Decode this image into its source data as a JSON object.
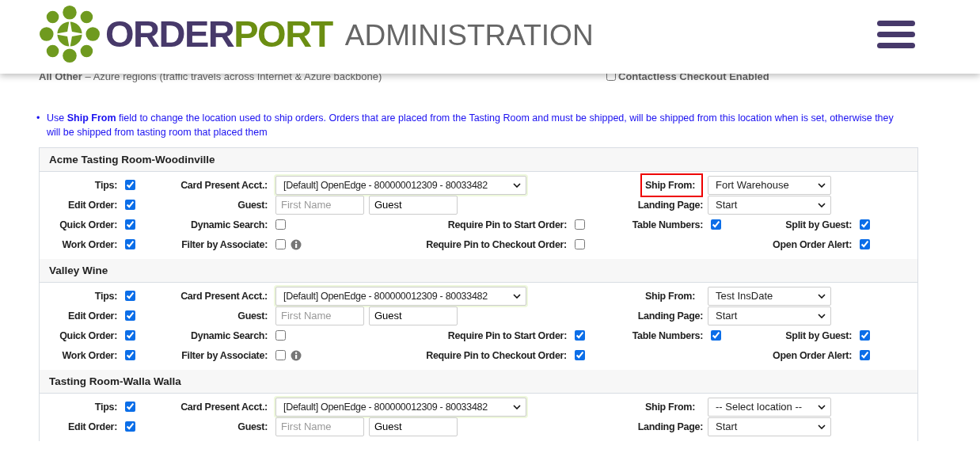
{
  "header": {
    "logo_word_1": "ORDER",
    "logo_word_2": "PORT",
    "subtitle": "ADMINISTRATION"
  },
  "behind_row": {
    "label": "All Other",
    "text": "– Azure regions (traffic travels across Internet & Azure backbone)",
    "checkbox": {
      "label": "Contactless Checkout Enabled",
      "checked": false
    }
  },
  "notes": [
    {
      "marker": "•",
      "text": "Use **Ship From** field to change the location used to ship orders. Orders that are placed from the Tasting Room and must be shipped, will be shipped from this location when is set, otherwise they will be shipped from tasting room that placed them"
    }
  ],
  "locations": [
    {
      "name": "Acme Tasting Room-Woodinville",
      "tips": {
        "label": "Tips:",
        "checked": true
      },
      "edit_order": {
        "label": "Edit Order:",
        "checked": true
      },
      "quick_order": {
        "label": "Quick Order:",
        "checked": true
      },
      "work_order": {
        "label": "Work Order:",
        "checked": true
      },
      "card_present": {
        "label": "Card Present Acct.:",
        "value": "[Default] OpenEdge - 800000012309 - 80033482"
      },
      "guest": {
        "label": "Guest:",
        "first_placeholder": "First Name",
        "last_value": "Guest"
      },
      "dynamic_search": {
        "label": "Dynamic Search:",
        "checked": false
      },
      "filter_by_associate": {
        "label": "Filter by Associate:",
        "checked": false
      },
      "require_pin_start": {
        "label": "Require Pin to Start Order:",
        "checked": false
      },
      "require_pin_checkout": {
        "label": "Require Pin to Checkout Order:",
        "checked": false
      },
      "ship_from": {
        "label": "Ship From:",
        "value": "Fort Warehouse",
        "highlighted": true
      },
      "landing_page": {
        "label": "Landing Page:",
        "value": "Start"
      },
      "table_numbers": {
        "label": "Table Numbers:",
        "checked": true
      },
      "split_by_guest": {
        "label": "Split by Guest:",
        "checked": true
      },
      "open_order_alert": {
        "label": "Open Order Alert:",
        "checked": true
      }
    },
    {
      "name": "Valley Wine",
      "tips": {
        "label": "Tips:",
        "checked": true
      },
      "edit_order": {
        "label": "Edit Order:",
        "checked": true
      },
      "quick_order": {
        "label": "Quick Order:",
        "checked": true
      },
      "work_order": {
        "label": "Work Order:",
        "checked": true
      },
      "card_present": {
        "label": "Card Present Acct.:",
        "value": "[Default] OpenEdge - 800000012309 - 80033482"
      },
      "guest": {
        "label": "Guest:",
        "first_placeholder": "First Name",
        "last_value": "Guest"
      },
      "dynamic_search": {
        "label": "Dynamic Search:",
        "checked": false
      },
      "filter_by_associate": {
        "label": "Filter by Associate:",
        "checked": false
      },
      "require_pin_start": {
        "label": "Require Pin to Start Order:",
        "checked": true
      },
      "require_pin_checkout": {
        "label": "Require Pin to Checkout Order:",
        "checked": true
      },
      "ship_from": {
        "label": "Ship From:",
        "value": "Test InsDate",
        "highlighted": false
      },
      "landing_page": {
        "label": "Landing Page:",
        "value": "Start"
      },
      "table_numbers": {
        "label": "Table Numbers:",
        "checked": true
      },
      "split_by_guest": {
        "label": "Split by Guest:",
        "checked": true
      },
      "open_order_alert": {
        "label": "Open Order Alert:",
        "checked": true
      }
    },
    {
      "name": "Tasting Room-Walla Walla",
      "tips": {
        "label": "Tips:",
        "checked": true
      },
      "edit_order": {
        "label": "Edit Order:",
        "checked": true
      },
      "card_present": {
        "label": "Card Present Acct.:",
        "value": "[Default] OpenEdge - 800000012309 - 80033482"
      },
      "guest": {
        "label": "Guest:",
        "first_placeholder": "First Name",
        "last_value": "Guest"
      },
      "ship_from": {
        "label": "Ship From:",
        "value": "-- Select location --",
        "highlighted": false
      },
      "landing_page": {
        "label": "Landing Page:",
        "value": "Start"
      }
    }
  ]
}
